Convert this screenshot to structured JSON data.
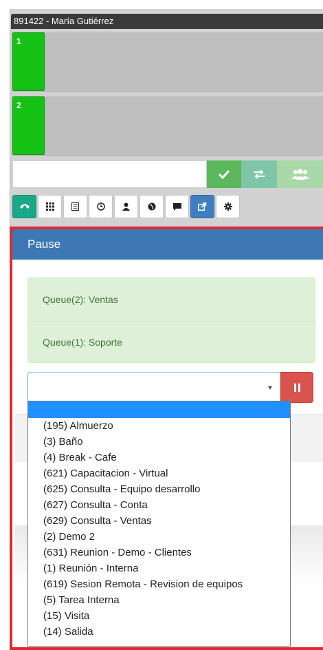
{
  "agent": {
    "title": "891422 - María Gutiérrez"
  },
  "lines": [
    {
      "number": "1"
    },
    {
      "number": "2"
    }
  ],
  "dial": {
    "value": ""
  },
  "toolbar": {
    "icons": [
      "phone-icon",
      "keypad-icon",
      "list-icon",
      "clock-icon",
      "user-icon",
      "globe-icon",
      "chat-icon",
      "logout-icon",
      "gear-icon"
    ],
    "active": "logout-icon"
  },
  "colors": {
    "line_green": "#16c116",
    "header_blue": "#3e78b4",
    "danger": "#d9534f",
    "highlight": "#e0282d",
    "dropdown_selected": "#1e90ff"
  },
  "pause": {
    "title": "Pause",
    "queues": [
      "Queue(2): Ventas",
      "Queue(1): Soporte"
    ],
    "selected_value": "",
    "options": [
      "",
      "(195) Almuerzo",
      "(3) Baño",
      "(4) Break - Cafe",
      "(621) Capacitacion - Virtual",
      "(625) Consulta - Equipo desarrollo",
      "(627) Consulta - Conta",
      "(629) Consulta - Ventas",
      "(2) Demo 2",
      "(631) Reunion - Demo - Clientes",
      "(1) Reunión - Interna",
      "(619) Sesion Remota - Revision de equipos",
      "(5) Tarea Interna",
      "(15) Visita",
      "(14) Salida"
    ]
  }
}
